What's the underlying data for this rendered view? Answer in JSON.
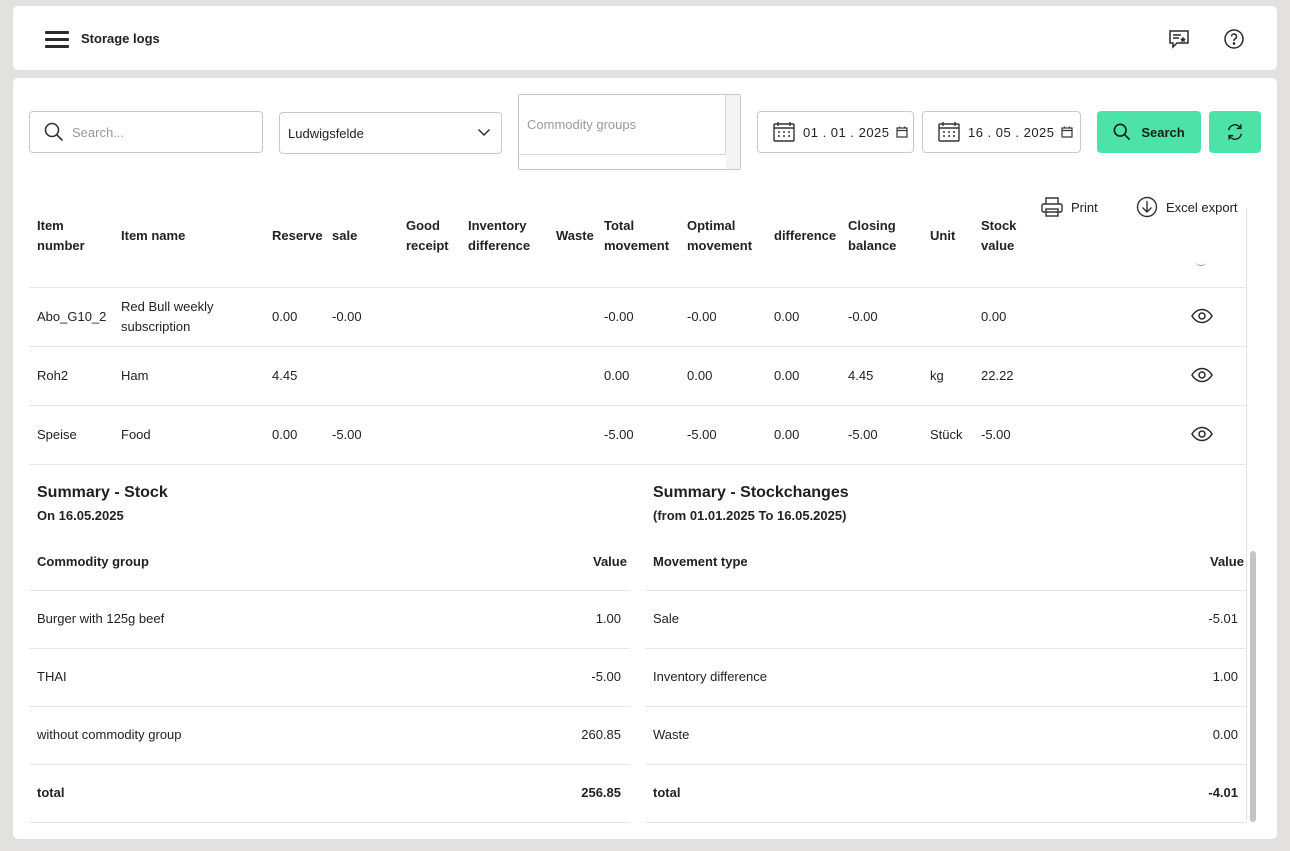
{
  "topbar": {
    "title": "Storage logs"
  },
  "filters": {
    "search_placeholder": "Search...",
    "location": "Ludwigsfelde",
    "commodity_placeholder": "Commodity groups",
    "date_from": "01 . 01 . 2025",
    "date_to": "16 . 05 . 2025",
    "search_label": "Search"
  },
  "tools": {
    "print": "Print",
    "excel": "Excel export"
  },
  "table": {
    "headers": {
      "item_number": [
        "Item",
        "number"
      ],
      "item_name": "Item name",
      "reserve": "Reserve",
      "sale": "sale",
      "good_receipt": [
        "Good",
        "receipt"
      ],
      "inventory_difference": [
        "Inventory",
        "difference"
      ],
      "waste": "Waste",
      "total_movement": [
        "Total",
        "movement"
      ],
      "optimal_movement": [
        "Optimal",
        "movement"
      ],
      "difference": "difference",
      "closing_balance": [
        "Closing",
        "balance"
      ],
      "unit": "Unit",
      "stock_value": [
        "Stock",
        "value"
      ]
    },
    "rows": [
      {
        "item_number": "Abo_G10_2",
        "item_name": [
          "Red Bull weekly",
          "subscription"
        ],
        "reserve": "0.00",
        "sale": "-0.00",
        "good_receipt": "",
        "inventory_difference": "",
        "waste": "",
        "total_movement": "-0.00",
        "optimal_movement": "-0.00",
        "difference": "0.00",
        "closing_balance": "-0.00",
        "unit": "",
        "stock_value": "0.00"
      },
      {
        "item_number": "Roh2",
        "item_name": [
          "Ham"
        ],
        "reserve": "4.45",
        "sale": "",
        "good_receipt": "",
        "inventory_difference": "",
        "waste": "",
        "total_movement": "0.00",
        "optimal_movement": "0.00",
        "difference": "0.00",
        "closing_balance": "4.45",
        "unit": "kg",
        "stock_value": "22.22"
      },
      {
        "item_number": "Speise",
        "item_name": [
          "Food"
        ],
        "reserve": "0.00",
        "sale": "-5.00",
        "good_receipt": "",
        "inventory_difference": "",
        "waste": "",
        "total_movement": "-5.00",
        "optimal_movement": "-5.00",
        "difference": "0.00",
        "closing_balance": "-5.00",
        "unit": "Stück",
        "stock_value": "-5.00"
      }
    ]
  },
  "summary_stock": {
    "title": "Summary - Stock",
    "subtitle": "On 16.05.2025",
    "col_left": "Commodity group",
    "col_right": "Value",
    "rows": [
      {
        "label": "Burger with 125g beef",
        "value": "1.00"
      },
      {
        "label": "THAI",
        "value": "-5.00"
      },
      {
        "label": "without commodity group",
        "value": "260.85"
      },
      {
        "label": "total",
        "value": "256.85"
      }
    ]
  },
  "summary_changes": {
    "title": "Summary - Stockchanges",
    "subtitle": "(from 01.01.2025 To 16.05.2025)",
    "col_left": "Movement type",
    "col_right": "Value",
    "rows": [
      {
        "label": "Sale",
        "value": "-5.01"
      },
      {
        "label": "Inventory difference",
        "value": "1.00"
      },
      {
        "label": "Waste",
        "value": "0.00"
      },
      {
        "label": "total",
        "value": "-4.01"
      }
    ]
  },
  "colors": {
    "accent": "#4de3a8",
    "background": "#e3e1df",
    "card": "#ffffff"
  },
  "icons": [
    "menu-icon",
    "feedback-icon",
    "help-icon",
    "search-icon",
    "chevron-down-icon",
    "calendar-icon",
    "refresh-icon",
    "print-icon",
    "download-icon",
    "eye-icon"
  ]
}
